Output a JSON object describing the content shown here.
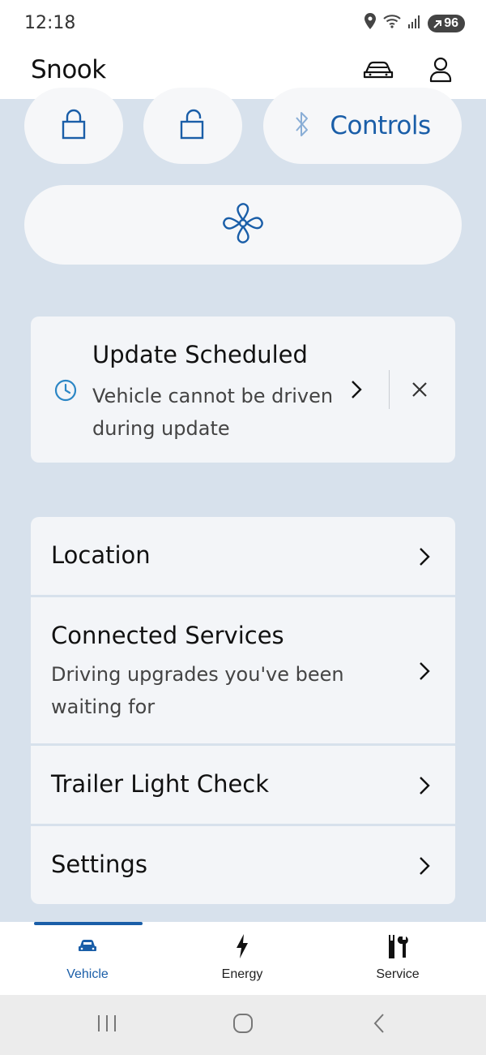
{
  "status_bar": {
    "time": "12:18",
    "battery": "96",
    "icons": [
      "location-icon",
      "wifi-icon",
      "signal-icon",
      "battery-icon"
    ]
  },
  "header": {
    "title": "Snook",
    "icons": [
      "vehicles-icon",
      "account-icon"
    ]
  },
  "quick_actions": {
    "lock": "lock-icon",
    "unlock": "unlock-icon",
    "controls_label": "Controls",
    "bluetooth": "bluetooth-icon",
    "climate": "fan-icon"
  },
  "update_card": {
    "title": "Update Scheduled",
    "description": "Vehicle cannot be driven during update",
    "icon": "clock-icon"
  },
  "menu": {
    "items": [
      {
        "label": "Location",
        "sublabel": ""
      },
      {
        "label": "Connected Services",
        "sublabel": "Driving upgrades you've been waiting for"
      },
      {
        "label": "Trailer Light Check",
        "sublabel": ""
      },
      {
        "label": "Settings",
        "sublabel": ""
      }
    ]
  },
  "bottom_nav": {
    "active": "Vehicle",
    "tabs": [
      {
        "label": "Vehicle",
        "icon": "car-icon"
      },
      {
        "label": "Energy",
        "icon": "bolt-icon"
      },
      {
        "label": "Service",
        "icon": "tools-icon"
      }
    ]
  },
  "colors": {
    "accent": "#1a5ea8",
    "background": "#d7e1ec",
    "card": "#f3f5f8"
  }
}
